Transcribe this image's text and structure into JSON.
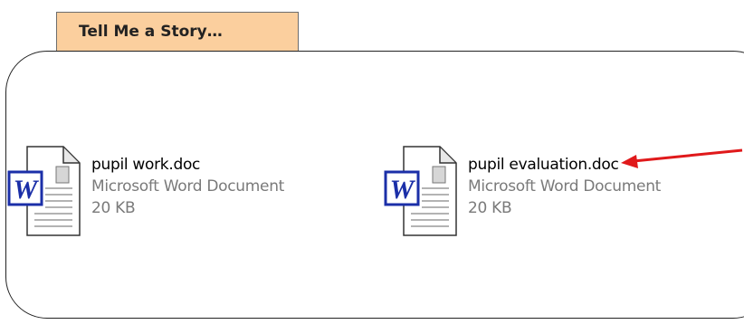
{
  "tab": {
    "title": "Tell Me a Story…"
  },
  "files": [
    {
      "name": "pupil work.doc",
      "type": "Microsoft Word Document",
      "size": "20 KB",
      "icon": "word-document-icon"
    },
    {
      "name": "pupil evaluation.doc",
      "type": "Microsoft Word Document",
      "size": "20 KB",
      "icon": "word-document-icon"
    }
  ],
  "colors": {
    "tab_bg": "#fbcf9e",
    "arrow": "#e0191b",
    "word_blue": "#1b2fa8"
  }
}
